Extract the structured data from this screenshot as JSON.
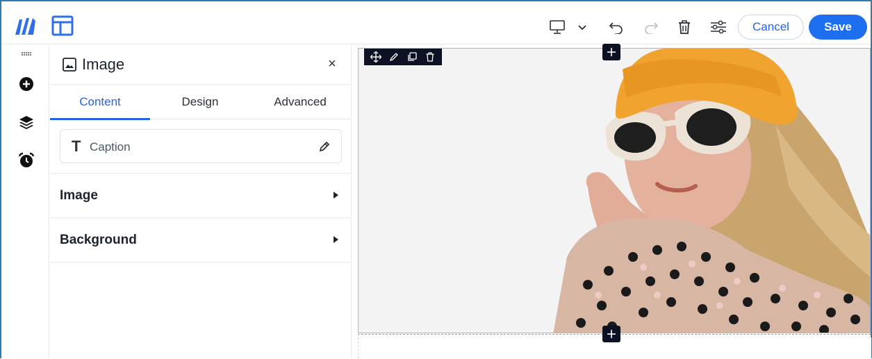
{
  "topbar": {
    "logo_icon": "brand-logo-icon",
    "layout_icon": "layout-icon",
    "device_icon": "desktop-icon",
    "chevron_icon": "chevron-down-icon",
    "undo_icon": "undo-icon",
    "redo_icon": "redo-icon",
    "trash_icon": "trash-icon",
    "settings_icon": "sliders-icon",
    "cancel_label": "Cancel",
    "save_label": "Save"
  },
  "rail": {
    "items": [
      {
        "name": "add",
        "icon": "plus-circle-icon"
      },
      {
        "name": "layers",
        "icon": "layers-icon"
      },
      {
        "name": "alarm",
        "icon": "alarm-clock-icon"
      }
    ]
  },
  "panel": {
    "title": "Image",
    "close_label": "×",
    "tabs": [
      {
        "label": "Content",
        "active": true
      },
      {
        "label": "Design",
        "active": false
      },
      {
        "label": "Advanced",
        "active": false
      }
    ],
    "caption": {
      "icon_letter": "T",
      "label": "Caption"
    },
    "sections": [
      {
        "label": "Image"
      },
      {
        "label": "Background"
      }
    ]
  },
  "canvas": {
    "element_tools": [
      "move-icon",
      "pencil-icon",
      "duplicate-icon",
      "trash-icon"
    ],
    "add_icon": "plus-icon"
  },
  "colors": {
    "accent": "#1e6ff0",
    "link": "#2563eb",
    "toolbar_dark": "#0c1224",
    "frame": "#2f7ab0"
  }
}
